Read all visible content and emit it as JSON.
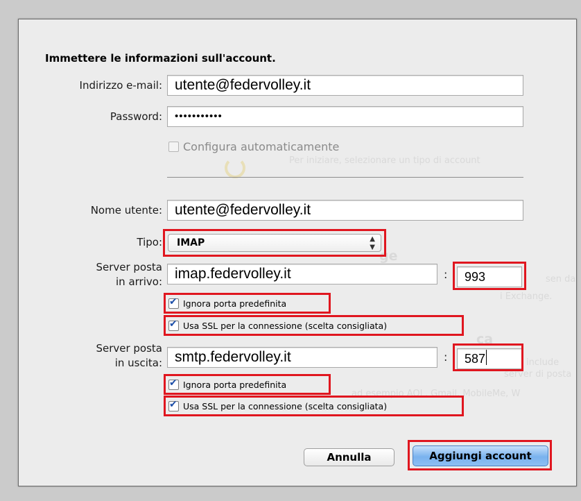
{
  "dialog": {
    "heading": "Immettere le informazioni sull'account."
  },
  "email": {
    "label": "Indirizzo e-mail:",
    "value": "utente@federvolley.it"
  },
  "password": {
    "label": "Password:",
    "value": "•••••••••••"
  },
  "auto_config": {
    "label": "Configura automaticamente",
    "checked": false,
    "enabled": false
  },
  "username": {
    "label": "Nome utente:",
    "value": "utente@federvolley.it"
  },
  "type": {
    "label": "Tipo:",
    "value": "IMAP"
  },
  "incoming": {
    "label_line1": "Server posta",
    "label_line2": "in arrivo:",
    "server": "imap.federvolley.it",
    "port": "993",
    "override_port_label": "Ignora porta predefinita",
    "ssl_label": "Usa SSL per la connessione (scelta consigliata)"
  },
  "outgoing": {
    "label_line1": "Server posta",
    "label_line2": "in uscita:",
    "server": "smtp.federvolley.it",
    "port": "587",
    "override_port_label": "Ignora porta predefinita",
    "ssl_label": "Usa SSL per la connessione (scelta consigliata)"
  },
  "buttons": {
    "cancel": "Annulla",
    "add": "Aggiungi account"
  },
  "colors": {
    "highlight": "#e0161f",
    "primary_button": "#79b2ee",
    "check": "#1d4fa8"
  },
  "icons": {
    "select_arrows": "up-down-arrows-icon",
    "check": "checkmark-icon"
  }
}
